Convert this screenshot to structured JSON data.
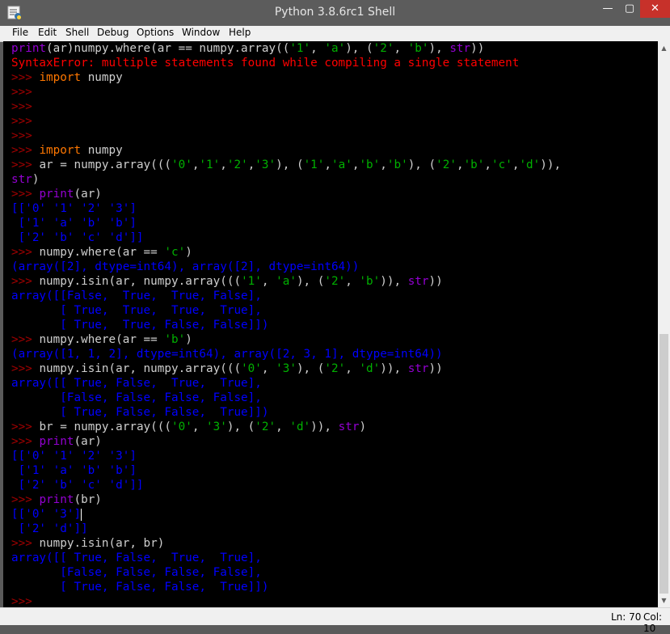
{
  "window": {
    "title": "Python 3.8.6rc1 Shell",
    "controls": {
      "minimize": "—",
      "maximize": "▢",
      "close": "✕"
    }
  },
  "menu": [
    "File",
    "Edit",
    "Shell",
    "Debug",
    "Options",
    "Window",
    "Help"
  ],
  "colors": {
    "background": "#000000",
    "prompt": "#a00000",
    "code": "#cfcfcf",
    "keyword": "#ff7700",
    "builtin": "#9400d3",
    "string": "#00b000",
    "output": "#0000ff",
    "error": "#ff0000"
  },
  "shell_lines": [
    [
      [
        "bi",
        "print"
      ],
      [
        "code",
        "(ar)numpy.where(ar == numpy.array(("
      ],
      [
        "str",
        "'1'"
      ],
      [
        "code",
        ", "
      ],
      [
        "str",
        "'a'"
      ],
      [
        "code",
        "), ("
      ],
      [
        "str",
        "'2'"
      ],
      [
        "code",
        ", "
      ],
      [
        "str",
        "'b'"
      ],
      [
        "code",
        "), "
      ],
      [
        "bi",
        "str"
      ],
      [
        "code",
        "))"
      ]
    ],
    [
      [
        "err",
        "SyntaxError: multiple statements found while compiling a single statement"
      ]
    ],
    [
      [
        "prompt",
        ">>> "
      ],
      [
        "kw",
        "import"
      ],
      [
        "code",
        " numpy"
      ]
    ],
    [
      [
        "prompt",
        ">>>"
      ]
    ],
    [
      [
        "prompt",
        ">>>"
      ]
    ],
    [
      [
        "prompt",
        ">>>"
      ]
    ],
    [
      [
        "prompt",
        ">>>"
      ]
    ],
    [
      [
        "prompt",
        ">>> "
      ],
      [
        "kw",
        "import"
      ],
      [
        "code",
        " numpy"
      ]
    ],
    [
      [
        "prompt",
        ">>> "
      ],
      [
        "code",
        "ar = numpy.array((("
      ],
      [
        "str",
        "'0'"
      ],
      [
        "code",
        ","
      ],
      [
        "str",
        "'1'"
      ],
      [
        "code",
        ","
      ],
      [
        "str",
        "'2'"
      ],
      [
        "code",
        ","
      ],
      [
        "str",
        "'3'"
      ],
      [
        "code",
        "), ("
      ],
      [
        "str",
        "'1'"
      ],
      [
        "code",
        ","
      ],
      [
        "str",
        "'a'"
      ],
      [
        "code",
        ","
      ],
      [
        "str",
        "'b'"
      ],
      [
        "code",
        ","
      ],
      [
        "str",
        "'b'"
      ],
      [
        "code",
        "), ("
      ],
      [
        "str",
        "'2'"
      ],
      [
        "code",
        ","
      ],
      [
        "str",
        "'b'"
      ],
      [
        "code",
        ","
      ],
      [
        "str",
        "'c'"
      ],
      [
        "code",
        ","
      ],
      [
        "str",
        "'d'"
      ],
      [
        "code",
        ")),"
      ]
    ],
    [
      [
        "bi",
        "str"
      ],
      [
        "code",
        ")"
      ]
    ],
    [
      [
        "prompt",
        ">>> "
      ],
      [
        "bi",
        "print"
      ],
      [
        "code",
        "(ar)"
      ]
    ],
    [
      [
        "out",
        "[['0' '1' '2' '3']"
      ]
    ],
    [
      [
        "out",
        " ['1' 'a' 'b' 'b']"
      ]
    ],
    [
      [
        "out",
        " ['2' 'b' 'c' 'd']]"
      ]
    ],
    [
      [
        "prompt",
        ">>> "
      ],
      [
        "code",
        "numpy.where(ar == "
      ],
      [
        "str",
        "'c'"
      ],
      [
        "code",
        ")"
      ]
    ],
    [
      [
        "out",
        "(array([2], dtype=int64), array([2], dtype=int64))"
      ]
    ],
    [
      [
        "prompt",
        ">>> "
      ],
      [
        "code",
        "numpy.isin(ar, numpy.array((("
      ],
      [
        "str",
        "'1'"
      ],
      [
        "code",
        ", "
      ],
      [
        "str",
        "'a'"
      ],
      [
        "code",
        "), ("
      ],
      [
        "str",
        "'2'"
      ],
      [
        "code",
        ", "
      ],
      [
        "str",
        "'b'"
      ],
      [
        "code",
        ")), "
      ],
      [
        "bi",
        "str"
      ],
      [
        "code",
        "))"
      ]
    ],
    [
      [
        "out",
        "array([[False,  True,  True, False],"
      ]
    ],
    [
      [
        "out",
        "       [ True,  True,  True,  True],"
      ]
    ],
    [
      [
        "out",
        "       [ True,  True, False, False]])"
      ]
    ],
    [
      [
        "prompt",
        ">>> "
      ],
      [
        "code",
        "numpy.where(ar == "
      ],
      [
        "str",
        "'b'"
      ],
      [
        "code",
        ")"
      ]
    ],
    [
      [
        "out",
        "(array([1, 1, 2], dtype=int64), array([2, 3, 1], dtype=int64))"
      ]
    ],
    [
      [
        "prompt",
        ">>> "
      ],
      [
        "code",
        "numpy.isin(ar, numpy.array((("
      ],
      [
        "str",
        "'0'"
      ],
      [
        "code",
        ", "
      ],
      [
        "str",
        "'3'"
      ],
      [
        "code",
        "), ("
      ],
      [
        "str",
        "'2'"
      ],
      [
        "code",
        ", "
      ],
      [
        "str",
        "'d'"
      ],
      [
        "code",
        ")), "
      ],
      [
        "bi",
        "str"
      ],
      [
        "code",
        "))"
      ]
    ],
    [
      [
        "out",
        "array([[ True, False,  True,  True],"
      ]
    ],
    [
      [
        "out",
        "       [False, False, False, False],"
      ]
    ],
    [
      [
        "out",
        "       [ True, False, False,  True]])"
      ]
    ],
    [
      [
        "prompt",
        ">>> "
      ],
      [
        "code",
        "br = numpy.array((("
      ],
      [
        "str",
        "'0'"
      ],
      [
        "code",
        ", "
      ],
      [
        "str",
        "'3'"
      ],
      [
        "code",
        "), ("
      ],
      [
        "str",
        "'2'"
      ],
      [
        "code",
        ", "
      ],
      [
        "str",
        "'d'"
      ],
      [
        "code",
        ")), "
      ],
      [
        "bi",
        "str"
      ],
      [
        "code",
        ")"
      ]
    ],
    [
      [
        "prompt",
        ">>> "
      ],
      [
        "bi",
        "print"
      ],
      [
        "code",
        "(ar)"
      ]
    ],
    [
      [
        "out",
        "[['0' '1' '2' '3']"
      ]
    ],
    [
      [
        "out",
        " ['1' 'a' 'b' 'b']"
      ]
    ],
    [
      [
        "out",
        " ['2' 'b' 'c' 'd']]"
      ]
    ],
    [
      [
        "prompt",
        ">>> "
      ],
      [
        "bi",
        "print"
      ],
      [
        "code",
        "(br)"
      ]
    ],
    [
      [
        "out",
        "[['0' '3']"
      ]
    ],
    [
      [
        "out",
        " ['2' 'd']]"
      ]
    ],
    [
      [
        "prompt",
        ">>> "
      ],
      [
        "code",
        "numpy.isin(ar, br)"
      ]
    ],
    [
      [
        "out",
        "array([[ True, False,  True,  True],"
      ]
    ],
    [
      [
        "out",
        "       [False, False, False, False],"
      ]
    ],
    [
      [
        "out",
        "       [ True, False, False,  True]])"
      ]
    ],
    [
      [
        "prompt",
        ">>> "
      ]
    ]
  ],
  "status": {
    "line": "Ln: 70",
    "col": "Col: 10"
  }
}
